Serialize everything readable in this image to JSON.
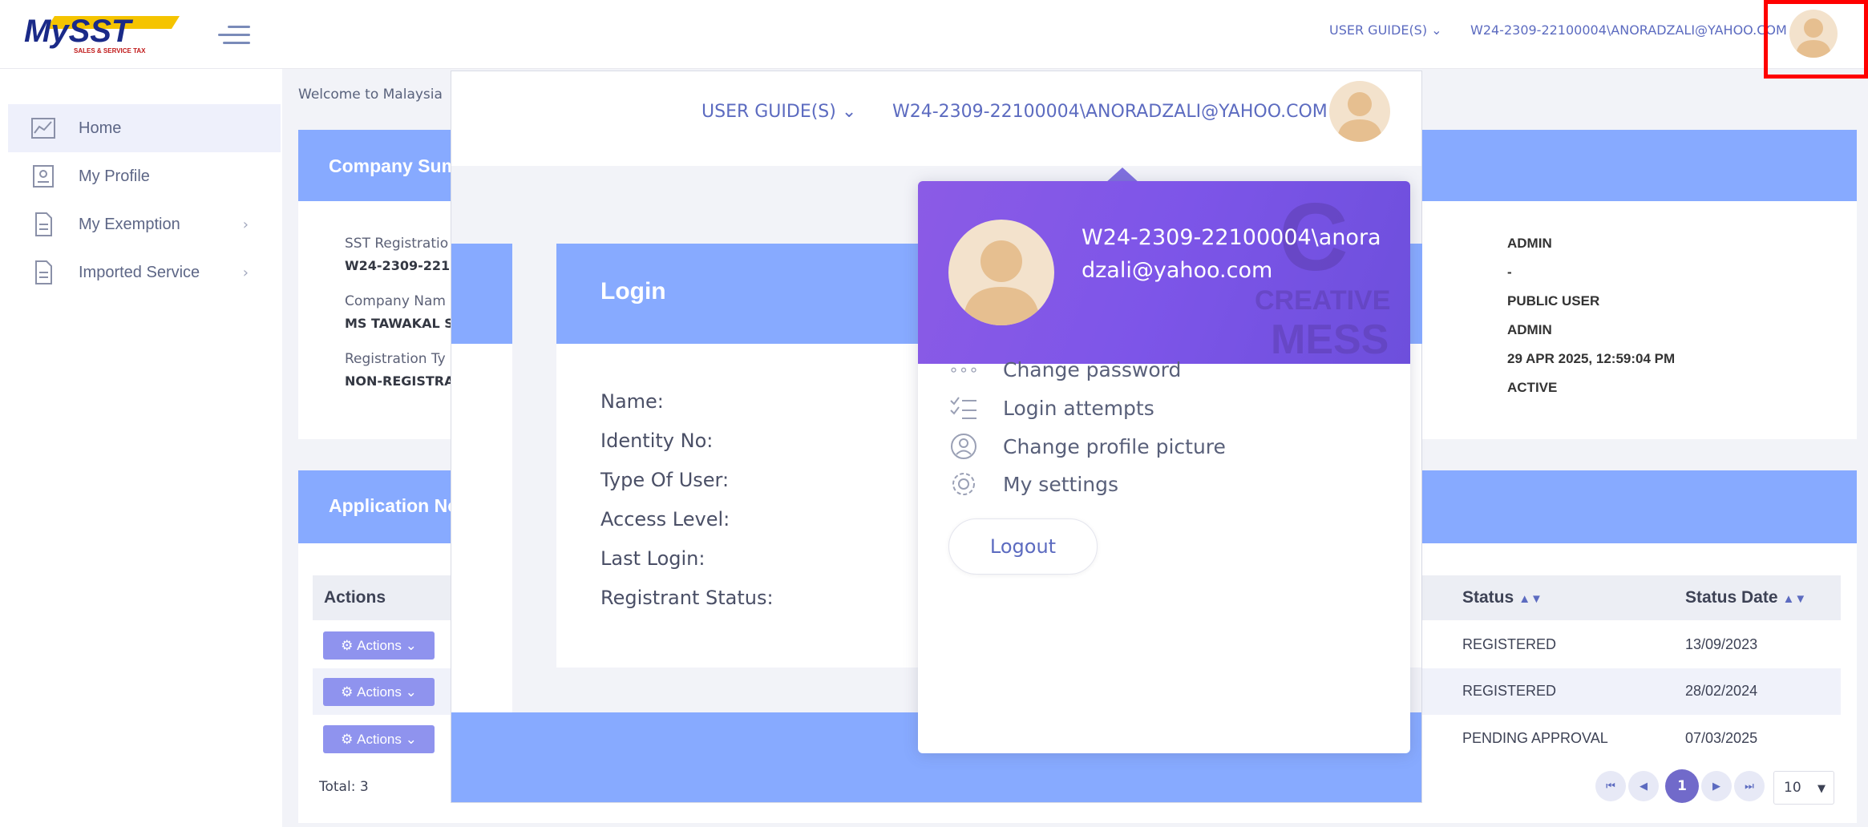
{
  "header": {
    "logo_text": "MySST",
    "logo_subtext": "SALES & SERVICE TAX",
    "user_guide_label": "USER GUIDE(S)",
    "user_label": "W24-2309-22100004\\ANORADZALI@YAHOO.COM"
  },
  "sidebar": {
    "items": [
      {
        "label": "Home"
      },
      {
        "label": "My Profile"
      },
      {
        "label": "My Exemption",
        "chevron": "›"
      },
      {
        "label": "Imported Service",
        "chevron": "›"
      }
    ]
  },
  "main": {
    "welcome": "Welcome to Malaysia",
    "company_summary_title": "Company Sum",
    "sst_registration_label": "SST Registratio",
    "sst_registration_value": "W24-2309-221",
    "company_name_label": "Company Nam",
    "company_name_value": "MS TAWAKAL S",
    "registration_type_label": "Registration Ty",
    "registration_type_value": "NON-REGISTRA",
    "right_values": [
      "ADMIN",
      "-",
      "PUBLIC USER",
      "ADMIN",
      "29 APR 2025, 12:59:04 PM",
      "ACTIVE"
    ],
    "application_title": "Application No",
    "table": {
      "headers": {
        "actions": "Actions",
        "status": "Status",
        "status_date": "Status Date"
      },
      "action_label": "Actions",
      "rows": [
        {
          "status": "REGISTERED",
          "date": "13/09/2023"
        },
        {
          "status": "REGISTERED",
          "date": "28/02/2024"
        },
        {
          "status": "PENDING APPROVAL",
          "date": "07/03/2025"
        }
      ],
      "total": "Total: 3"
    },
    "pagination": {
      "current": "1",
      "page_size": "10"
    }
  },
  "overlay": {
    "user_guide_label": "USER GUIDE(S)",
    "user_label": "W24-2309-22100004\\ANORADZALI@YAHOO.COM",
    "login_title": "Login",
    "fields": [
      "Name:",
      "Identity No:",
      "Type Of User:",
      "Access Level:",
      "Last Login:",
      "Registrant Status:"
    ],
    "dropdown": {
      "user": "W24-2309-22100004\\anoradzali@yahoo.com",
      "deco_text": [
        "C",
        "CREATIVE",
        "MESS"
      ],
      "items": [
        {
          "label": "Change password",
          "icon": "dots-icon"
        },
        {
          "label": "Login attempts",
          "icon": "checklist-icon"
        },
        {
          "label": "Change profile picture",
          "icon": "profile-icon"
        },
        {
          "label": "My settings",
          "icon": "gear-icon"
        }
      ],
      "logout_label": "Logout"
    }
  },
  "colors": {
    "accent": "#5c6bc0",
    "card_header": "#87aaff",
    "dropdown_header": "#7d55e8",
    "action_button": "#8f93ee",
    "highlight_box": "#ff0000"
  }
}
